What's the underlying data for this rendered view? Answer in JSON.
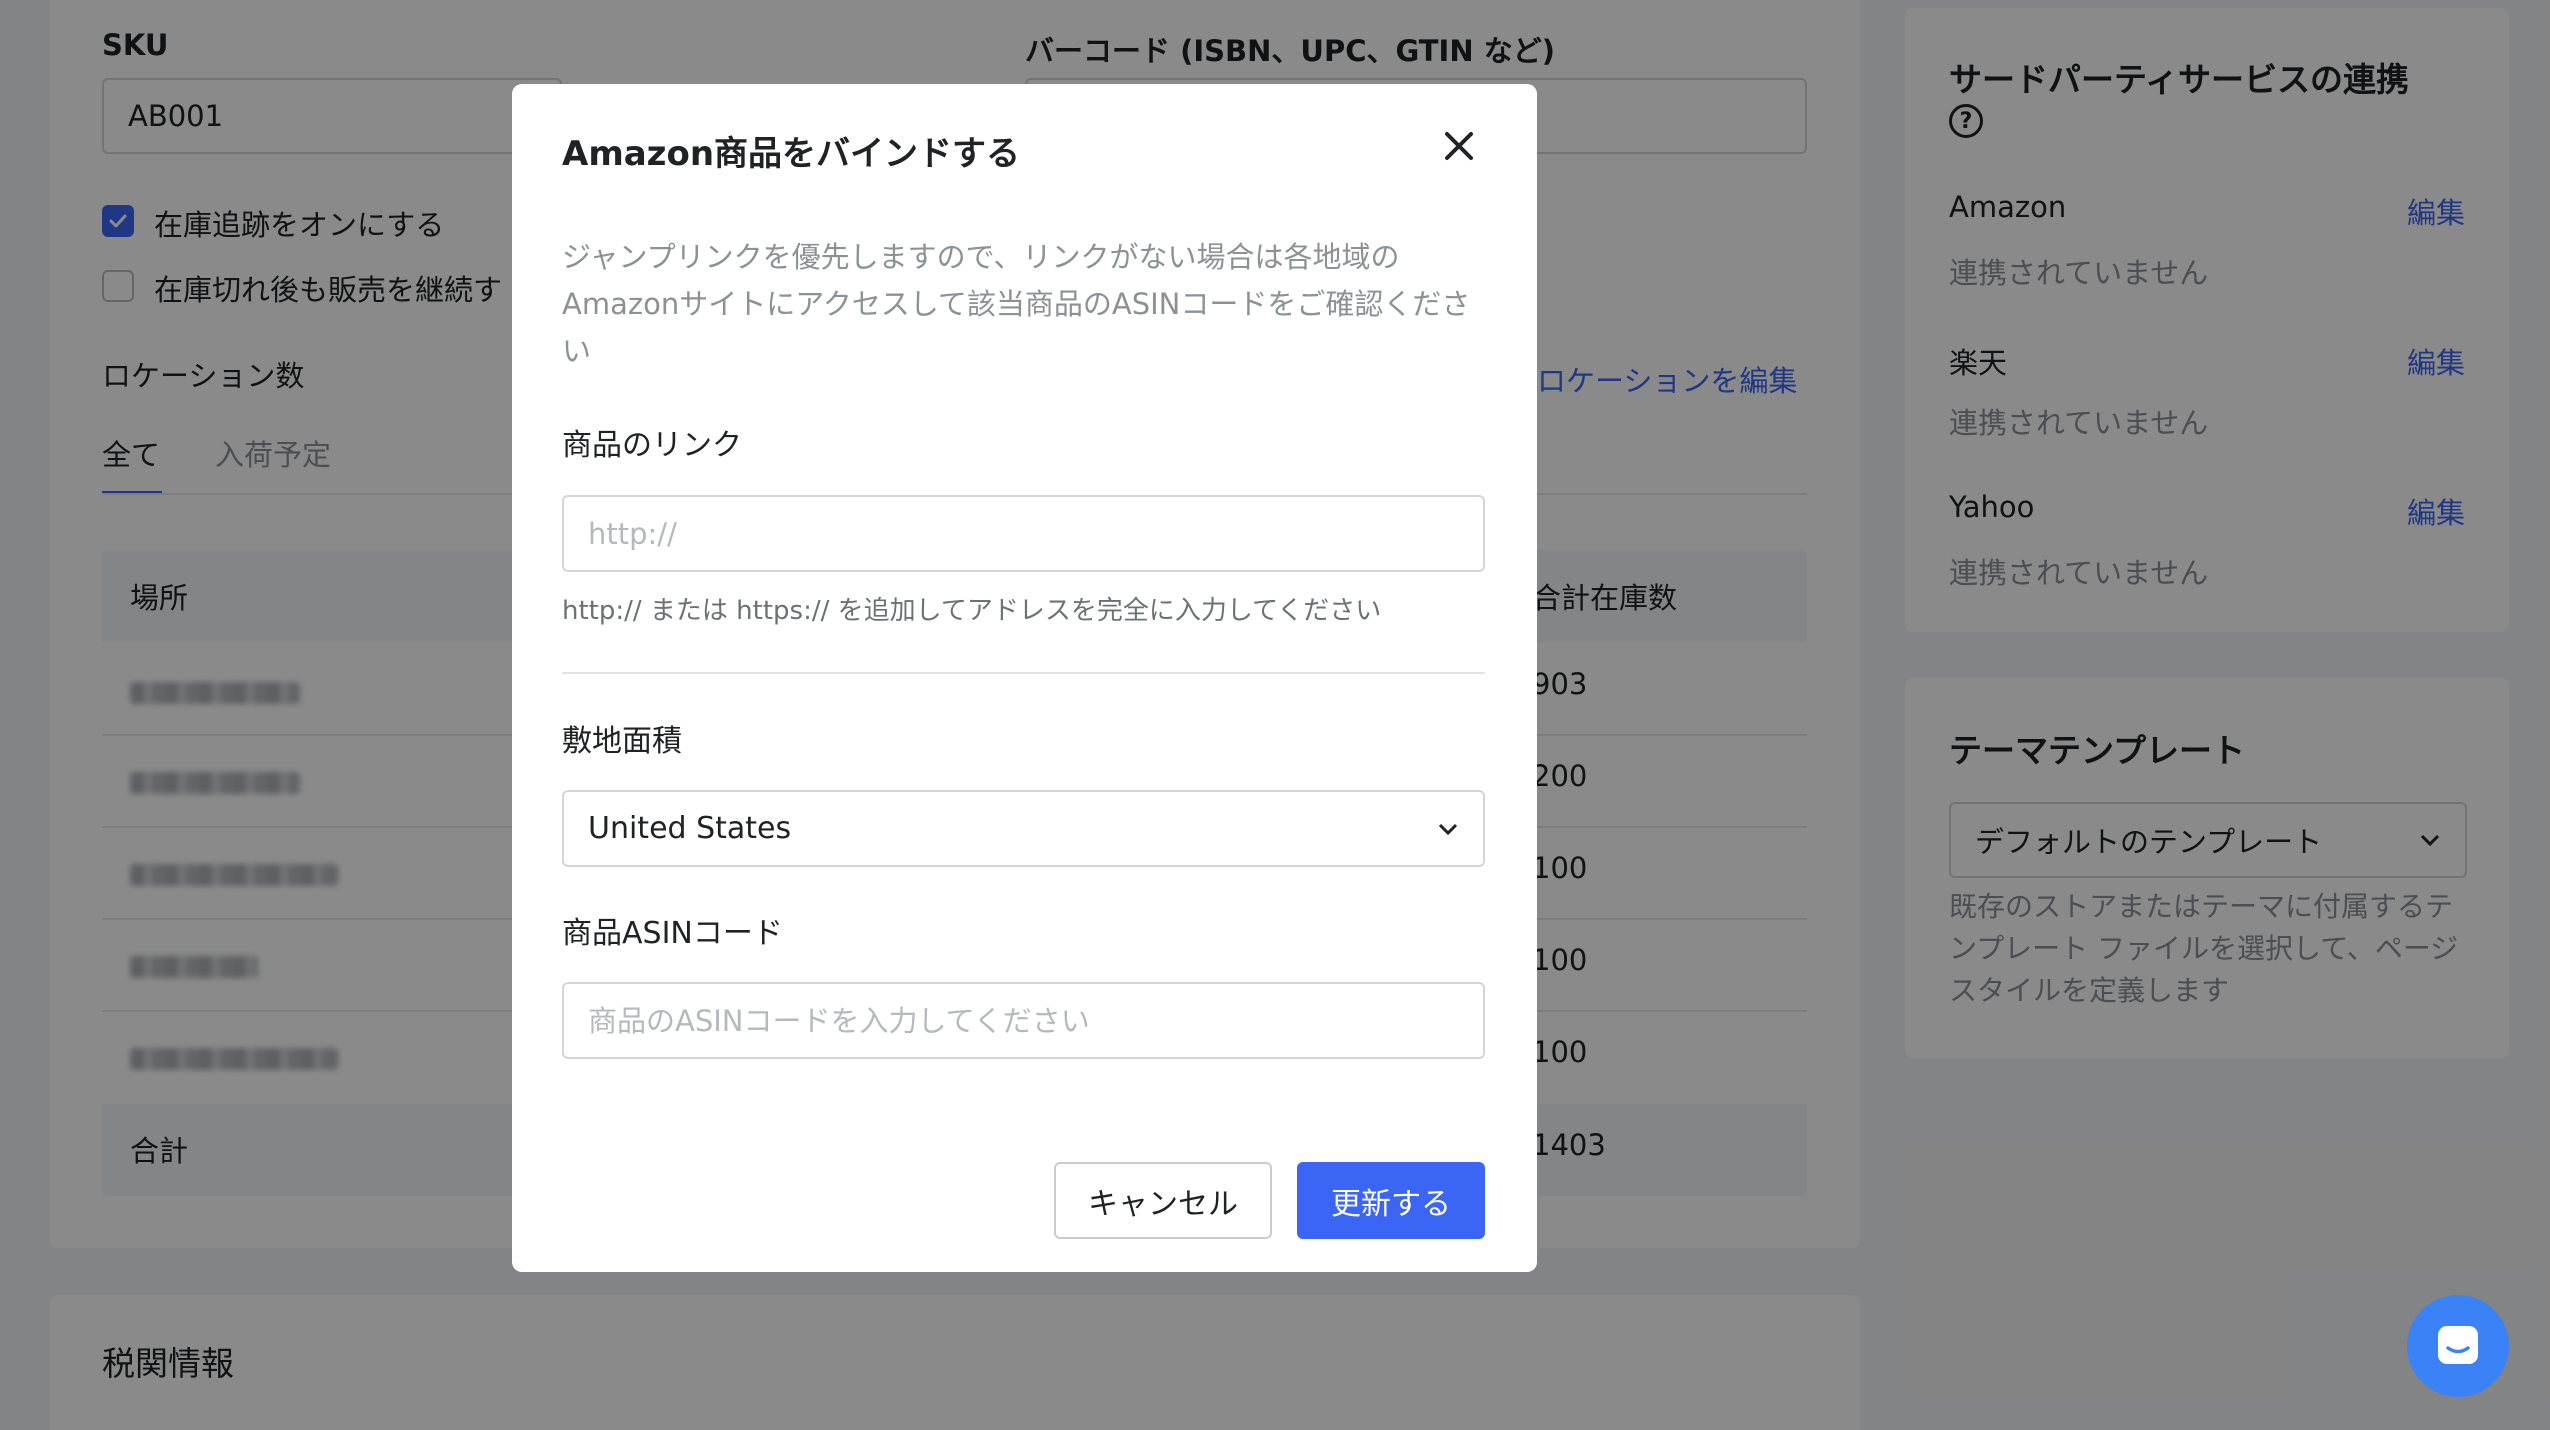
{
  "product": {
    "sku_label": "SKU",
    "sku_value": "AB001",
    "barcode_label": "バーコード (ISBN、UPC、GTIN など)",
    "track_inventory_label": "在庫追跡をオンにする",
    "continue_selling_label": "在庫切れ後も販売を継続す",
    "location_count_label": "ロケーション数",
    "edit_locations_link": "ロケーションを編集",
    "tabs": [
      {
        "label": "全て"
      },
      {
        "label": "入荷予定"
      }
    ],
    "table": {
      "col_location": "場所",
      "col_total_stock": "合計在庫数",
      "rows": [
        {
          "total": "903"
        },
        {
          "total": "200"
        },
        {
          "total": "100"
        },
        {
          "total": "100"
        },
        {
          "total": "100"
        }
      ],
      "sum_label": "合計",
      "sum_value": "1403"
    },
    "customs_title": "税関情報"
  },
  "sidebar": {
    "integrations_title": "サードパーティサービスの連携",
    "integrations": [
      {
        "name": "Amazon",
        "edit": "編集",
        "status": "連携されていません"
      },
      {
        "name": "楽天",
        "edit": "編集",
        "status": "連携されていません"
      },
      {
        "name": "Yahoo",
        "edit": "編集",
        "status": "連携されていません"
      }
    ],
    "theme_title": "テーマテンプレート",
    "theme_select": "デフォルトのテンプレート",
    "theme_help": "既存のストアまたはテーマに付属するテンプレート ファイルを選択して、ページ スタイルを定義します"
  },
  "modal": {
    "title": "Amazon商品をバインドする",
    "description": "ジャンプリンクを優先しますので、リンクがない場合は各地域のAmazonサイトにアクセスして該当商品のASINコードをご確認ください",
    "link_label": "商品のリンク",
    "link_placeholder": "http://",
    "link_help": "http:// または https:// を追加してアドレスを完全に入力してください",
    "region_label": "敷地面積",
    "region_value": "United States",
    "asin_label": "商品ASINコード",
    "asin_placeholder": "商品のASINコードを入力してください",
    "cancel_label": "キャンセル",
    "submit_label": "更新する"
  },
  "colors": {
    "accent": "#3b66f5",
    "overlay": "rgba(0,0,0,0.46)"
  }
}
